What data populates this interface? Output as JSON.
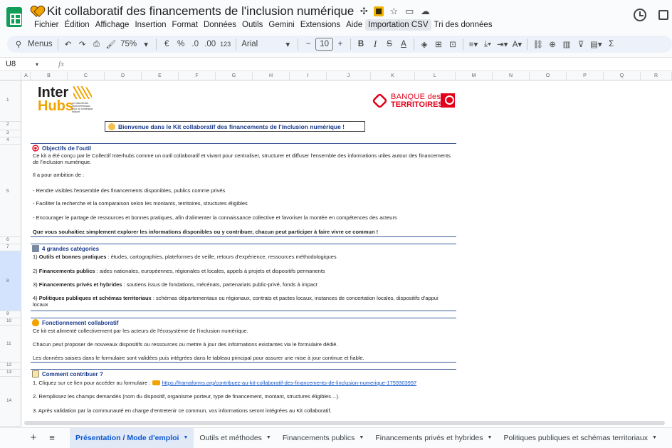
{
  "window": {
    "title": "Kit collaboratif des financements de l'inclusion numérique",
    "menu": [
      "Fichier",
      "Édition",
      "Affichage",
      "Insertion",
      "Format",
      "Données",
      "Outils",
      "Gemini",
      "Extensions",
      "Aide",
      "Importation CSV",
      "Tri des données"
    ]
  },
  "toolbar": {
    "search": "Menus",
    "zoom": "75%",
    "currency": "€",
    "percent": "%",
    "dec_less": ".0",
    "dec_more": ".00",
    "format_123": "123",
    "font": "Arial",
    "minus": "−",
    "font_size": "10",
    "plus": "+",
    "bold": "B",
    "italic": "I",
    "strike": "S",
    "text_color": "A",
    "sigma": "Σ"
  },
  "formula_bar": {
    "cell": "U8",
    "fx": "fx"
  },
  "columns": [
    "A",
    "B",
    "C",
    "D",
    "E",
    "F",
    "G",
    "H",
    "I",
    "J",
    "K",
    "L",
    "M",
    "N",
    "O",
    "P",
    "Q",
    "R"
  ],
  "rows": [
    "1",
    "2",
    "3",
    "4",
    "5",
    "6",
    "7",
    "8",
    "9",
    "10",
    "11",
    "12",
    "13",
    "14"
  ],
  "logos": {
    "interhubs_1": "Inter",
    "interhubs_2": "Hubs",
    "interhubs_small": "Le collectif des Hubs territoriaux pour un numérique inclusif",
    "bdt_1": "BANQUE des",
    "bdt_2": "TERRITOIRES"
  },
  "content": {
    "welcome": "Bienvenue dans le Kit collaboratif des financements de l'inclusion numérique !",
    "sec1_title": "Objectifs de l'outil",
    "sec1_p1": "Ce kit a été conçu par le Collectif Interhubs comme un outil collaboratif et vivant pour centraliser, structurer et diffuser l'ensemble des informations utiles autour des financements de l'inclusion numérique.",
    "sec1_p2": "Il a pour ambition de :",
    "sec1_b1": "- Rendre visibles l'ensemble des financements disponibles, publics comme privés",
    "sec1_b2": "- Faciliter la recherche et la comparaison selon les montants, territoires, structures éligibles",
    "sec1_b3": "- Encourager le partage de ressources et bonnes pratiques, afin d'alimenter la connaissance collective et favoriser la montée en compétences des acteurs",
    "sec1_bold": "Que vous souhaitiez simplement explorer les informations disponibles ou y contribuer, chacun peut participer à faire vivre ce commun !",
    "sec2_title": "4 grandes catégories",
    "sec2_l1_b": "Outils et bonnes pratiques",
    "sec2_l1_n": "1) ",
    "sec2_l1_t": " : études, cartographies, plateformes de veille, retours d'expérience, ressources méthodologiques",
    "sec2_l2_n": "2) ",
    "sec2_l2_b": "Financements publics",
    "sec2_l2_t": " : aides nationales, européennes, régionales et locales, appels à projets et dispositifs permanents",
    "sec2_l3_n": "3) ",
    "sec2_l3_b": "Financements privés et hybrides",
    "sec2_l3_t": " : soutiens issus de fondations, mécénats, partenariats public-privé, fonds à impact",
    "sec2_l4_n": "4) ",
    "sec2_l4_b": "Politiques publiques et schémas territoriaux",
    "sec2_l4_t": " : schémas départementaux ou régionaux, contrats et pactes locaux, instances de concertation locales, dispositifs d'appui locaux",
    "sec3_title": "Fonctionnement collaboratif",
    "sec3_p1": "Ce kit est alimenté collectivement par les acteurs de l'écosystème de l'inclusion numérique.",
    "sec3_p2": "Chacun peut proposer de nouveaux dispositifs ou ressources ou mettre à jour des informations existantes via le formulaire dédié.",
    "sec3_p3": "Les données saisies dans le formulaire sont validées puis intégrées dans le tableau principal pour assurer une mise à jour continue et fiable.",
    "sec4_title": "Comment contribuer ?",
    "sec4_s1": "1. Cliquez sur ce lien pour accéder au formulaire :",
    "sec4_link": "https://framaforms.org/contribuez-au-kit-collaboratif-des-financements-de-linclusion-numerique-1759303997",
    "sec4_s2": "2. Remplissez les champs demandés (nom du dispositif, organisme porteur, type de financement, montant, structures éligibles…).",
    "sec4_s3": "3. Après validation par la communauté en charge d'entretenir ce commun, vos informations seront intégrées au Kit collaboratif."
  },
  "tabs": [
    "Présentation / Mode d'emploi",
    "Outils et méthodes",
    "Financements publics",
    "Financements privés et hybrides",
    "Politiques publiques et schémas territoriaux"
  ]
}
